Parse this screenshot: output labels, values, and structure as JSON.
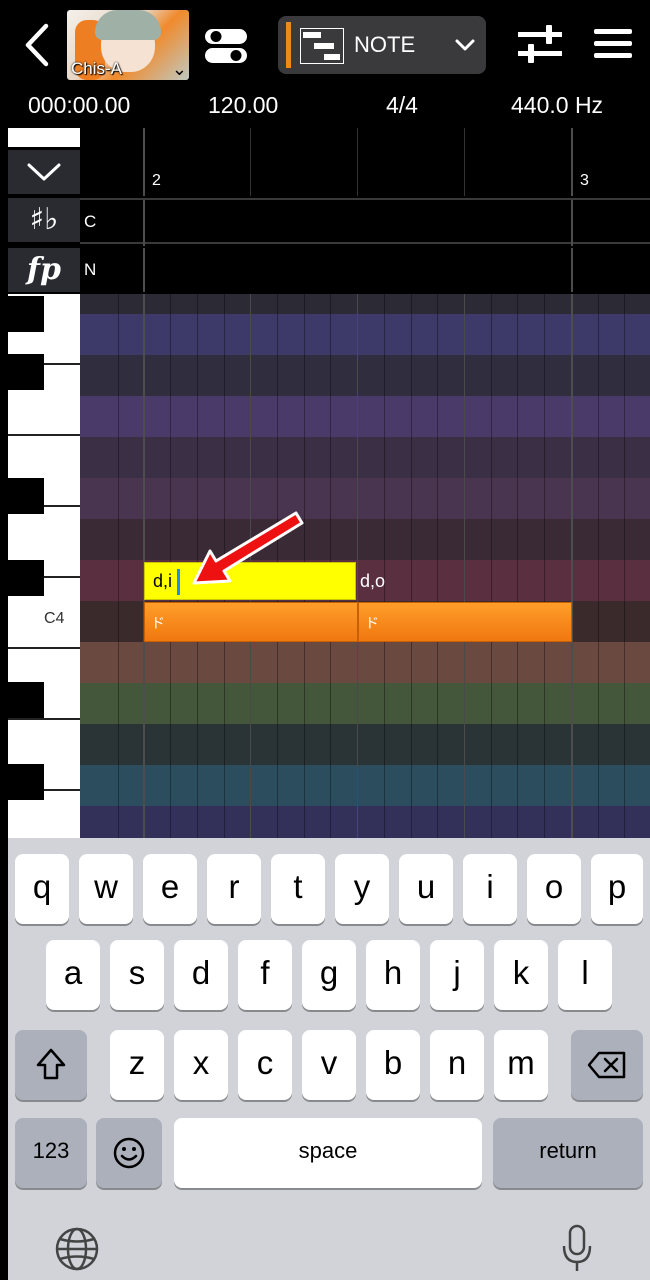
{
  "header": {
    "back_icon": "chevron-left-icon",
    "singer_name": "Chis-A",
    "mode_label": "NOTE",
    "accent_color": "#ee8a1a"
  },
  "info": {
    "position": "000:00.00",
    "tempo": "120.00",
    "time_signature": "4/4",
    "tuning": "440.0 Hz"
  },
  "ruler": {
    "measure_labels": [
      "2",
      "3"
    ]
  },
  "rows": {
    "key_row_icon": "♯♭",
    "key_value": "C",
    "dynamics_row_icon": "fp",
    "dynamics_value": "N"
  },
  "piano": {
    "c4_label": "C4"
  },
  "notes": [
    {
      "lyric_input": "d,i",
      "phoneme": "ド",
      "selected": true
    },
    {
      "lyric": "d,o",
      "phoneme": "ド",
      "selected": false
    }
  ],
  "keyboard": {
    "row1": [
      "q",
      "w",
      "e",
      "r",
      "t",
      "y",
      "u",
      "i",
      "o",
      "p"
    ],
    "row2": [
      "a",
      "s",
      "d",
      "f",
      "g",
      "h",
      "j",
      "k",
      "l"
    ],
    "row3": [
      "z",
      "x",
      "c",
      "v",
      "b",
      "n",
      "m"
    ],
    "numbers_key": "123",
    "space_key": "space",
    "return_key": "return"
  }
}
